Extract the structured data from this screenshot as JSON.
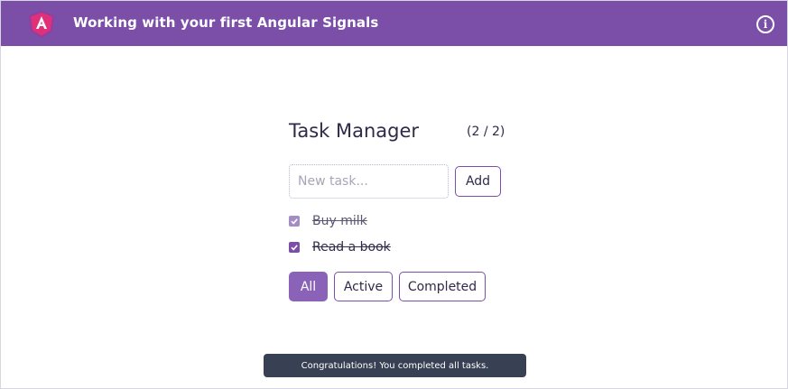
{
  "header": {
    "title": "Working with your first Angular Signals",
    "info_icon": "info-icon",
    "color": "#7b4fa8"
  },
  "task_manager": {
    "title": "Task Manager",
    "counter": "(2 / 2)",
    "input": {
      "placeholder": "New task...",
      "value": ""
    },
    "add_label": "Add",
    "tasks": [
      {
        "label": "Buy milk",
        "completed": true
      },
      {
        "label": "Read a book",
        "completed": true
      }
    ],
    "filters": [
      {
        "label": "All",
        "selected": true
      },
      {
        "label": "Active",
        "selected": false
      },
      {
        "label": "Completed",
        "selected": false
      }
    ]
  },
  "toast": {
    "message": "Congratulations! You completed all tasks."
  },
  "colors": {
    "accent": "#7b4fa8",
    "toast_bg": "#384053"
  }
}
